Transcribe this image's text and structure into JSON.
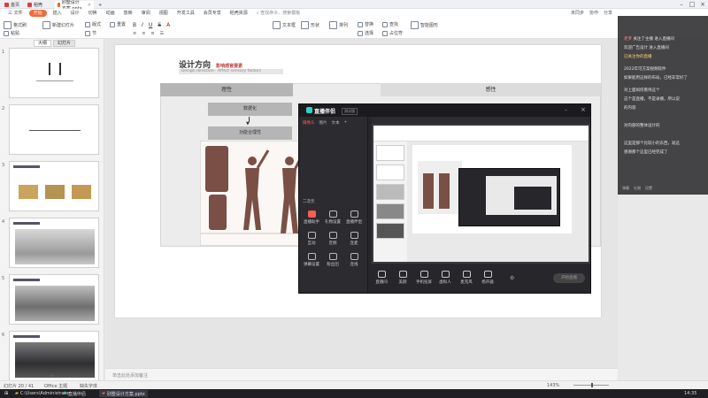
{
  "titlebar": {
    "tabs": [
      {
        "label": "首页",
        "color": "#e33b3b"
      },
      {
        "label": "稻壳",
        "color": "#e33b3b"
      },
      {
        "label": "别墅设计方案.pptx",
        "color": "#e6692f"
      }
    ],
    "add_tab": "+"
  },
  "menubar": {
    "file": "三 文件",
    "start": "开始",
    "items": [
      "插入",
      "设计",
      "切换",
      "动画",
      "放映",
      "审阅",
      "视图",
      "开发工具",
      "会员专享",
      "稻壳资源"
    ],
    "search": "查找命令、搜索模板"
  },
  "ribbon": {
    "tools": [
      "格式刷",
      "粘贴",
      "新建幻灯片",
      "版式",
      "节",
      "重置",
      "文本框",
      "形状",
      "排列",
      "替换",
      "选择",
      "查找",
      "占位符",
      "智能图形"
    ],
    "right": [
      "未同步",
      "协作",
      "分享"
    ]
  },
  "leftpanel": {
    "tabs": [
      "大纲",
      "幻灯片"
    ],
    "thumbs": [
      {
        "num": "1"
      },
      {
        "num": "2"
      },
      {
        "num": "3"
      },
      {
        "num": "4"
      },
      {
        "num": "5"
      },
      {
        "num": "6"
      }
    ]
  },
  "slide": {
    "title": "设计方向",
    "subtitle_cn": "影响感官要素",
    "subtitle_en": "Design direction · Affect sensory factors",
    "col1": "理性",
    "col2": "感性",
    "box1": "数据化",
    "box2": "功能合理性"
  },
  "notes": {
    "placeholder": "单击此处添加备注"
  },
  "statusbar": {
    "slide_pos": "幻灯片 20 / 41",
    "theme": "Office 主题",
    "font_missing": "缺失字体",
    "zoom": "143%"
  },
  "chat": {
    "messages": [
      {
        "name": "老罗",
        "text": "关注了主播 进入直播间"
      },
      {
        "name": "",
        "text": "欢迎广告设计 进入直播间"
      },
      {
        "name": "",
        "text": "已关注你的直播"
      },
      {
        "name": "",
        "text": "2022年可方案视频软件"
      },
      {
        "name": "",
        "text": "如果能用这样的布局，已经非常好了"
      },
      {
        "name": "",
        "text": "对上面如何看待这个"
      },
      {
        "name": "",
        "text": "这个是直播，不是录播，所以说"
      },
      {
        "name": "",
        "text": "的内容"
      },
      {
        "name": "",
        "text": "对内部的整体设计的"
      },
      {
        "name": "",
        "text": "这里是那个比较小的东西，就这"
      },
      {
        "name": "",
        "text": "感谢那个这里已经完成了"
      }
    ],
    "bottom": [
      "弹幕",
      "礼物",
      "设置"
    ]
  },
  "stream": {
    "logo": "直播伴侣",
    "version": "测试版",
    "side_tabs": [
      "摄像头",
      "图片",
      "文本",
      "+"
    ],
    "grid": [
      {
        "label": "直播助手"
      },
      {
        "label": "礼物设置"
      },
      {
        "label": "直播伴侣"
      },
      {
        "label": "互动"
      },
      {
        "label": "音频"
      },
      {
        "label": "连麦"
      },
      {
        "label": "弹幕设置"
      },
      {
        "label": "粉丝团"
      },
      {
        "label": "连线"
      }
    ],
    "scene_label": "二次元",
    "bottom_items": [
      "直播间",
      "美颜",
      "手机投屏",
      "虚拟人",
      "麦克风",
      "扬声器"
    ],
    "start_live": "开始直播"
  },
  "taskbar": {
    "items": [
      "C:\\Users\\Administrator",
      "直播伴侣",
      "别墅设计方案.pptx"
    ],
    "time": "14:35"
  }
}
